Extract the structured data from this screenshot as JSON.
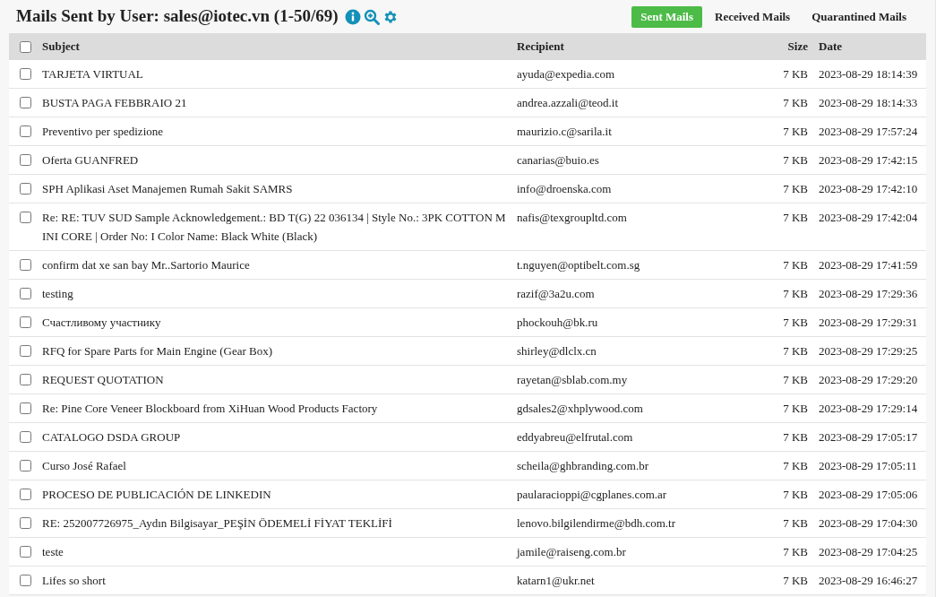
{
  "title": "Mails Sent by User: sales@iotec.vn (1-50/69)",
  "tabs": [
    {
      "label": "Sent Mails",
      "selected": true
    },
    {
      "label": "Received Mails",
      "selected": false
    },
    {
      "label": "Quarantined Mails",
      "selected": false
    }
  ],
  "table": {
    "select_all": {
      "checked": false
    },
    "columns": [
      "Subject",
      "Recipient",
      "Size",
      "Date"
    ],
    "rows": [
      {
        "checked": false,
        "subject": "TARJETA VIRTUAL",
        "recipient": "ayuda@expedia.com",
        "size": "7 KB",
        "date": "2023-08-29 18:14:39"
      },
      {
        "checked": false,
        "subject": "BUSTA PAGA FEBBRAIO 21",
        "recipient": "andrea.azzali@teod.it",
        "size": "7 KB",
        "date": "2023-08-29 18:14:33"
      },
      {
        "checked": false,
        "subject": "Preventivo per spedizione",
        "recipient": "maurizio.c@sarila.it",
        "size": "7 KB",
        "date": "2023-08-29 17:57:24"
      },
      {
        "checked": false,
        "subject": "Oferta GUANFRED",
        "recipient": "canarias@buio.es",
        "size": "7 KB",
        "date": "2023-08-29 17:42:15"
      },
      {
        "checked": false,
        "subject": "SPH Aplikasi Aset Manajemen Rumah Sakit SAMRS",
        "recipient": "info@droenska.com",
        "size": "7 KB",
        "date": "2023-08-29 17:42:10"
      },
      {
        "checked": false,
        "subject": "Re: RE: TUV SUD Sample Acknowledgement.: BD T(G) 22 036134 | Style No.: 3PK COTTON MINI CORE | Order No: I Color Name: Black White (Black)",
        "recipient": "nafis@texgroupltd.com",
        "size": "7 KB",
        "date": "2023-08-29 17:42:04"
      },
      {
        "checked": false,
        "subject": "confirm dat xe san bay Mr..Sartorio Maurice",
        "recipient": "t.nguyen@optibelt.com.sg",
        "size": "7 KB",
        "date": "2023-08-29 17:41:59"
      },
      {
        "checked": false,
        "subject": "testing",
        "recipient": "razif@3a2u.com",
        "size": "7 KB",
        "date": "2023-08-29 17:29:36"
      },
      {
        "checked": false,
        "subject": "Счастливому участнику",
        "recipient": "phockouh@bk.ru",
        "size": "7 KB",
        "date": "2023-08-29 17:29:31"
      },
      {
        "checked": false,
        "subject": "RFQ for Spare Parts for Main Engine (Gear Box)",
        "recipient": "shirley@dlclx.cn",
        "size": "7 KB",
        "date": "2023-08-29 17:29:25"
      },
      {
        "checked": false,
        "subject": "REQUEST QUOTATION",
        "recipient": "rayetan@sblab.com.my",
        "size": "7 KB",
        "date": "2023-08-29 17:29:20"
      },
      {
        "checked": false,
        "subject": "Re: Pine Core Veneer Blockboard from XiHuan Wood Products Factory",
        "recipient": "gdsales2@xhplywood.com",
        "size": "7 KB",
        "date": "2023-08-29 17:29:14"
      },
      {
        "checked": false,
        "subject": "CATALOGO DSDA GROUP",
        "recipient": "eddyabreu@elfrutal.com",
        "size": "7 KB",
        "date": "2023-08-29 17:05:17"
      },
      {
        "checked": false,
        "subject": "Curso José Rafael",
        "recipient": "scheila@ghbranding.com.br",
        "size": "7 KB",
        "date": "2023-08-29 17:05:11"
      },
      {
        "checked": false,
        "subject": "PROCESO DE PUBLICACIÓN DE LINKEDIN",
        "recipient": "paularacioppi@cgplanes.com.ar",
        "size": "7 KB",
        "date": "2023-08-29 17:05:06"
      },
      {
        "checked": false,
        "subject": "RE: 252007726975_Aydın Bilgisayar_PEŞİN ÖDEMELİ FİYAT TEKLİFİ",
        "recipient": "lenovo.bilgilendirme@bdh.com.tr",
        "size": "7 KB",
        "date": "2023-08-29 17:04:30"
      },
      {
        "checked": false,
        "subject": "teste",
        "recipient": "jamile@raiseng.com.br",
        "size": "7 KB",
        "date": "2023-08-29 17:04:25"
      },
      {
        "checked": false,
        "subject": "Lifes so short",
        "recipient": "katarn1@ukr.net",
        "size": "7 KB",
        "date": "2023-08-29 16:46:27"
      }
    ]
  }
}
